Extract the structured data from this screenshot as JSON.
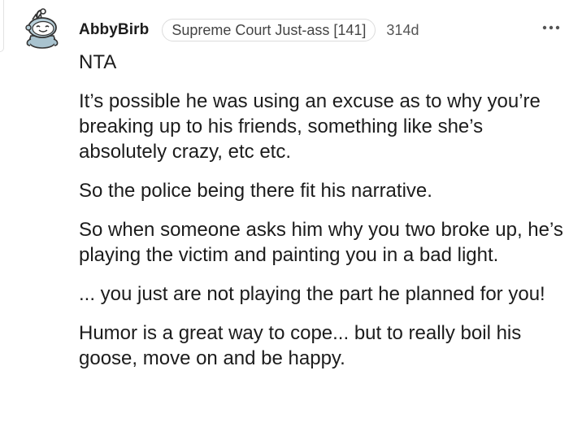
{
  "comment": {
    "author": "AbbyBirb",
    "flair": "Supreme Court Just-ass [141]",
    "age": "314d",
    "paragraphs": [
      "NTA",
      "It’s possible he was using an excuse as to why you’re breaking up to his friends, something like she’s absolutely crazy, etc etc.",
      "So the police being there fit his narrative.",
      "So when someone asks him why you two broke up, he’s playing the victim and painting you in a bad light.",
      "... you just are not playing the part he planned for you!",
      "Humor is a great way to cope... but to really boil his goose, move on and be happy."
    ]
  },
  "icons": {
    "avatar": "snoo-avatar-icon",
    "more": "more-options-icon"
  },
  "colors": {
    "text": "#1c1c1c",
    "flair_border": "#dcdcdc",
    "meta": "#555555",
    "avatar_fill": "#9fb8c4"
  }
}
